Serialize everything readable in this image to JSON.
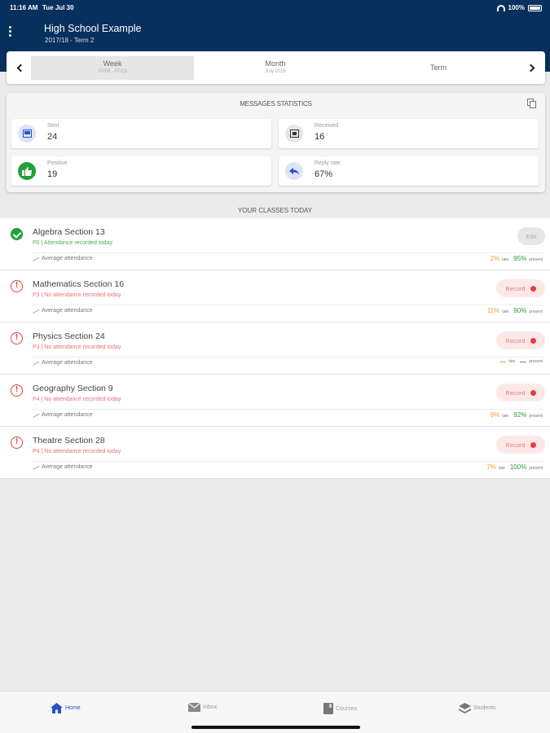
{
  "status_bar": {
    "time": "11:16 AM",
    "date": "Tue Jul 30",
    "battery": "100%"
  },
  "header": {
    "school": "High School Example",
    "term": "2017/18 - Term 2"
  },
  "periods": [
    {
      "label": "Week",
      "sub": "07/08 - 07/13",
      "active": true
    },
    {
      "label": "Month",
      "sub": "July 2019",
      "active": false
    },
    {
      "label": "Term",
      "sub": "",
      "active": false
    }
  ],
  "statistics": {
    "title": "MESSAGES STATISTICS",
    "items": [
      {
        "name": "sent",
        "label": "Sent",
        "value": "24",
        "icon": "inbox-tray-icon"
      },
      {
        "name": "received",
        "label": "Received",
        "value": "16",
        "icon": "inbox-icon"
      },
      {
        "name": "positive",
        "label": "Positive",
        "value": "19",
        "icon": "thumbs-up-icon"
      },
      {
        "name": "reply-rate",
        "label": "Reply rate",
        "value": "67%",
        "icon": "reply-icon"
      }
    ]
  },
  "classes_title": "YOUR CLASSES TODAY",
  "classes": [
    {
      "name": "Algebra Section 13",
      "note": "P0 | Attendance recorded today",
      "status": "ok",
      "action": "Edit",
      "avg_label": "Average attendance",
      "late": "2%",
      "present": "95%"
    },
    {
      "name": "Mathematics Section 16",
      "note": "P3 | No attendance recorded today",
      "status": "warn",
      "action": "Record",
      "avg_label": "Average attendance",
      "late": "11%",
      "present": "90%"
    },
    {
      "name": "Physics Section 24",
      "note": "P3 | No attendance recorded today",
      "status": "warn",
      "action": "Record",
      "avg_label": "Average attendance",
      "late": "",
      "present": ""
    },
    {
      "name": "Geography Section 9",
      "note": "P4 | No attendance recorded today",
      "status": "warn",
      "action": "Record",
      "avg_label": "Average attendance",
      "late": "9%",
      "present": "92%"
    },
    {
      "name": "Theatre Section 28",
      "note": "P4 | No attendance recorded today",
      "status": "warn",
      "action": "Record",
      "avg_label": "Average attendance",
      "late": "7%",
      "present": "100%"
    }
  ],
  "labels": {
    "late": "late",
    "present": "present"
  },
  "nav": [
    {
      "label": "Home",
      "icon": "home-icon",
      "active": true
    },
    {
      "label": "Inbox",
      "icon": "mail-icon",
      "active": false
    },
    {
      "label": "Courses",
      "icon": "book-icon",
      "active": false
    },
    {
      "label": "Students",
      "icon": "layers-icon",
      "active": false
    }
  ],
  "colors": {
    "header": "#07305c",
    "accent": "#2850c8",
    "present": "#2e9d3a",
    "late": "#f0a030",
    "alert": "#e53e3e"
  }
}
